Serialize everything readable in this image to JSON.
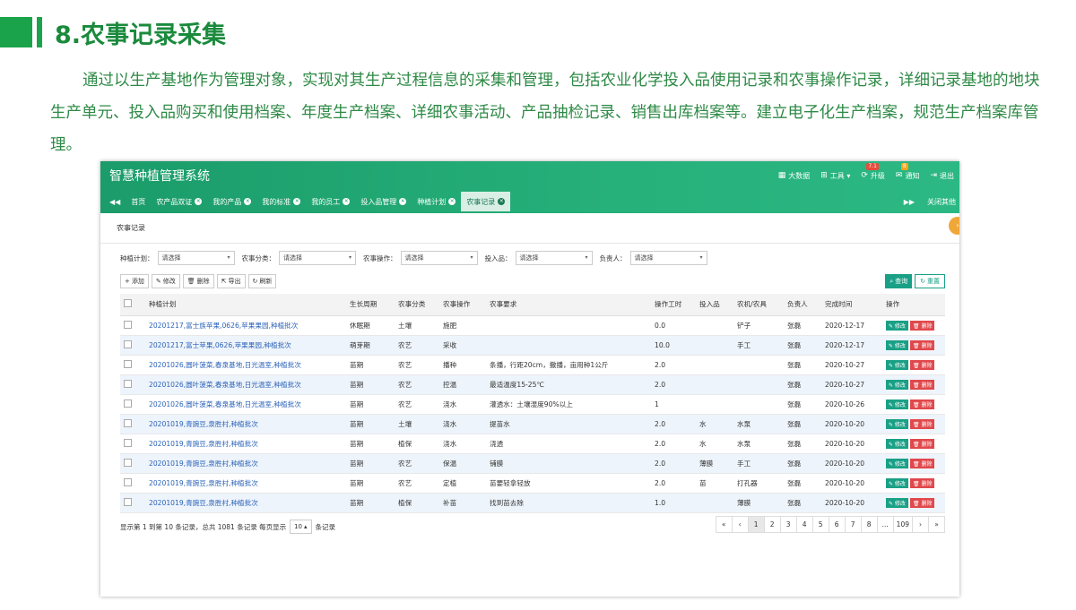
{
  "slide": {
    "title": "8.农事记录采集",
    "intro": "通过以生产基地作为管理对象，实现对其生产过程信息的采集和管理，包括农业化学投入品使用记录和农事操作记录，详细记录基地的地块生产单元、投入品购买和使用档案、年度生产档案、详细农事活动、产品抽检记录、销售出库档案等。建立电子化生产档案，规范生产档案库管理。"
  },
  "app": {
    "title": "智慧种植管理系统",
    "header_items": [
      {
        "icon": "grid-icon",
        "label": "大数据"
      },
      {
        "icon": "windows-icon",
        "label": "工具 ▾"
      },
      {
        "icon": "upgrade-icon",
        "label": "升级",
        "badge": "7.1"
      },
      {
        "icon": "mail-icon",
        "label": "通知",
        "badge": "8"
      },
      {
        "icon": "logout-icon",
        "label": "退出"
      }
    ],
    "tabs": [
      "首页",
      "农产品双证",
      "我的产品",
      "我的标准",
      "我的员工",
      "投入品管理",
      "种植计划",
      "农事记录"
    ],
    "active_tab": "农事记录",
    "close_others": "关闭其他",
    "panel_title": "农事记录",
    "filters": [
      {
        "label": "种植计划：",
        "value": "请选择"
      },
      {
        "label": "农事分类：",
        "value": "请选择"
      },
      {
        "label": "农事操作：",
        "value": "请选择"
      },
      {
        "label": "投入品：",
        "value": "请选择"
      },
      {
        "label": "负责人：",
        "value": "请选择"
      }
    ],
    "toolbar": {
      "add": "添加",
      "edit": "修改",
      "delete": "删除",
      "export": "导出",
      "refresh": "刷新",
      "query": "查询",
      "reset": "重置"
    },
    "columns": [
      "种植计划",
      "生长周期",
      "农事分类",
      "农事操作",
      "农事要求",
      "操作工时",
      "投入品",
      "农机/农具",
      "负责人",
      "完成时间",
      "操作"
    ],
    "rows": [
      [
        "20201217,富士族苹果,0626,苹果果园,种植批次",
        "休眠期",
        "土壤",
        "施肥",
        "",
        "0.0",
        "",
        "铲子",
        "张磊",
        "2020-12-17"
      ],
      [
        "20201217,富士苹果,0626,苹果果园,种植批次",
        "萌芽期",
        "农艺",
        "采收",
        "",
        "10.0",
        "",
        "手工",
        "张磊",
        "2020-12-17"
      ],
      [
        "20201026,圆叶菠菜,春泉基地,日光温室,种植批次",
        "苗期",
        "农艺",
        "播种",
        "条播，行距20cm，撒播，亩用种1公斤",
        "2.0",
        "",
        "",
        "张磊",
        "2020-10-27"
      ],
      [
        "20201026,圆叶菠菜,春泉基地,日光温室,种植批次",
        "苗期",
        "农艺",
        "控温",
        "最适温度15-25℃",
        "2.0",
        "",
        "",
        "张磊",
        "2020-10-27"
      ],
      [
        "20201026,圆叶菠菜,春泉基地,日光温室,种植批次",
        "苗期",
        "农艺",
        "浇水",
        "灌透水：土壤湿度90%以上",
        "1",
        "",
        "",
        "张磊",
        "2020-10-26"
      ],
      [
        "20201019,青豌豆,泉胜村,种植批次",
        "苗期",
        "土壤",
        "浇水",
        "提苗水",
        "2.0",
        "水",
        "水泵",
        "张磊",
        "2020-10-20"
      ],
      [
        "20201019,青豌豆,泉胜村,种植批次",
        "苗期",
        "植保",
        "浇水",
        "浇透",
        "2.0",
        "水",
        "水泵",
        "张磊",
        "2020-10-20"
      ],
      [
        "20201019,青豌豆,泉胜村,种植批次",
        "苗期",
        "农艺",
        "保温",
        "铺膜",
        "2.0",
        "薄膜",
        "手工",
        "张磊",
        "2020-10-20"
      ],
      [
        "20201019,青豌豆,泉胜村,种植批次",
        "苗期",
        "农艺",
        "定植",
        "苗要轻拿轻放",
        "2.0",
        "苗",
        "打孔器",
        "张磊",
        "2020-10-20"
      ],
      [
        "20201019,青豌豆,泉胜村,种植批次",
        "苗期",
        "植保",
        "补苗",
        "找到苗去除",
        "1.0",
        "",
        "薄膜",
        "张磊",
        "2020-10-20"
      ]
    ],
    "row_actions": {
      "edit": "修改",
      "delete": "删除"
    },
    "footer": {
      "info": "显示第 1 到第 10 条记录，总共 1081 条记录 每页显示",
      "page_size": "10",
      "suffix": "条记录"
    },
    "pager": [
      "«",
      "‹",
      "1",
      "2",
      "3",
      "4",
      "5",
      "6",
      "7",
      "8",
      "...",
      "109",
      "›",
      "»"
    ],
    "current_page": "1"
  }
}
